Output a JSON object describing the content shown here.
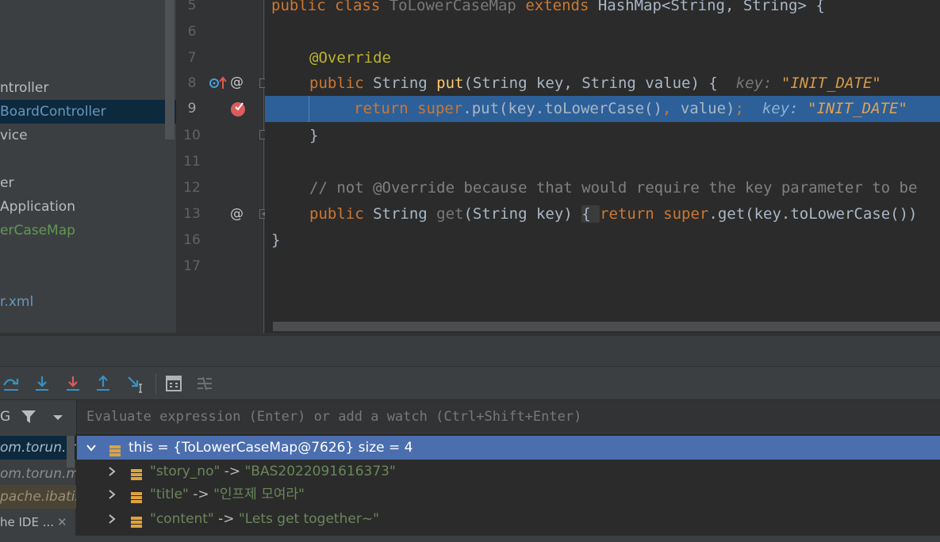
{
  "project_tree": [
    {
      "label": "ntroller",
      "style": "normal"
    },
    {
      "label": "BoardController",
      "style": "blue"
    },
    {
      "label": "vice",
      "style": "normal"
    },
    {
      "label": "er",
      "style": "normal"
    },
    {
      "label": "Application",
      "style": "normal"
    },
    {
      "label": "erCaseMap",
      "style": "green"
    },
    {
      "label": "r.xml",
      "style": "blue"
    }
  ],
  "editor": {
    "line_numbers": [
      "5",
      "6",
      "7",
      "8",
      "9",
      "10",
      "11",
      "12",
      "13",
      "16",
      "17"
    ],
    "current_line": "9",
    "lines": {
      "l5_kw1": "public class ",
      "l5_name": "ToLowerCaseMap",
      "l5_kw2": " extends ",
      "l5_rest": "HashMap<String, String> {",
      "l7_annotation": "@Override",
      "l8_kw": "public ",
      "l8_type": "String ",
      "l8_fn": "put",
      "l8_rest": "(String key, String value) {",
      "l8_inline_key": "key: ",
      "l8_inline_val": "\"INIT_DATE\"",
      "l9_kw1": "return ",
      "l9_kw2": "super",
      "l9_call": ".put(key.toLowerCase()",
      "l9_comma": ", ",
      "l9_rest": "value)",
      "l9_semi": ";",
      "l9_inline_key": "key: ",
      "l9_inline_val": "\"INIT_DATE\"",
      "l10": "}",
      "l12_comment": "// not @Override because that would require the key parameter to be",
      "l13_kw": "public ",
      "l13_type": "String ",
      "l13_fn": "get",
      "l13_args": "(String key) ",
      "l13_brace": "{ ",
      "l13_kw2": "return ",
      "l13_kw3": "super",
      "l13_rest": ".get(key.toLowerCase())",
      "l16": "}"
    }
  },
  "debugger": {
    "filter_label": "G",
    "watch_placeholder": "Evaluate expression (Enter) or add a watch (Ctrl+Shift+Enter)",
    "frames": [
      {
        "label": "om.torun.mto",
        "state": "selected"
      },
      {
        "label": "om.torun.mto",
        "state": "normal"
      },
      {
        "label": "pache.ibatis.r",
        "state": "library"
      },
      {
        "label": "he IDE ...",
        "state": "normal"
      }
    ],
    "frame_close_glyph": "✕",
    "variables": {
      "root": {
        "text": "this = {ToLowerCaseMap@7626}  size = 4"
      },
      "entries": [
        {
          "key": "\"story_no\"",
          "arrow": " -> ",
          "value": "\"BAS2022091616373\""
        },
        {
          "key": "\"title\"",
          "arrow": " -> ",
          "value": "\"인프제 모여라\""
        },
        {
          "key": "\"content\"",
          "arrow": " -> ",
          "value": "\"Lets get together~\""
        }
      ]
    }
  },
  "icons": {
    "gutter_line8_override": "override-up-arrow-icon",
    "gutter_at": "@",
    "breakpoint": "breakpoint-checked-icon",
    "toolbar": [
      "step-over-icon",
      "step-into-icon",
      "force-step-into-icon",
      "step-out-icon",
      "run-to-cursor-icon",
      "evaluate-expression-icon",
      "trace-current-stream-icon"
    ]
  },
  "colors": {
    "editor_bg": "#2b2b2b",
    "current_line_bg": "#2d6099",
    "selected_variable_bg": "#4b6eaf",
    "keyword": "#cc7832",
    "annotation": "#bbb529",
    "method": "#ffc66d",
    "string": "#6a8759",
    "breakpoint": "#db5c5c"
  }
}
